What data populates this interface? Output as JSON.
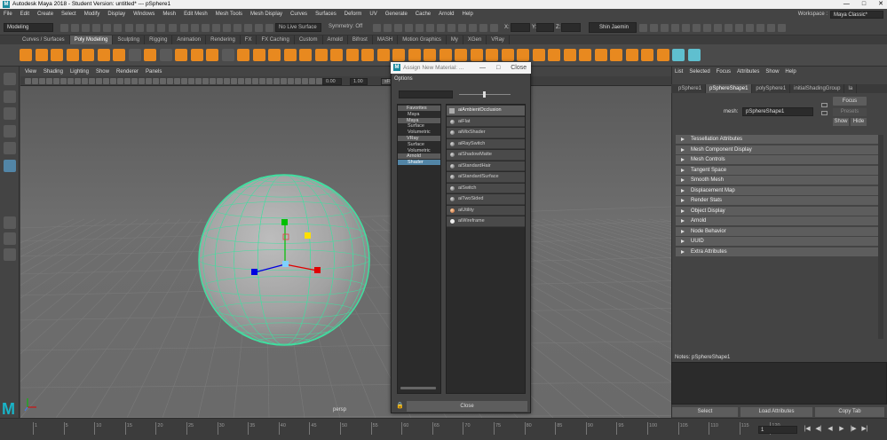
{
  "window": {
    "title": "Autodesk Maya 2018 - Student Version: untitled*   ---   pSphere1",
    "logo": "M",
    "min": "—",
    "max": "□",
    "close": "✕"
  },
  "menubar": {
    "items": [
      "File",
      "Edit",
      "Create",
      "Select",
      "Modify",
      "Display",
      "Windows",
      "Mesh",
      "Edit Mesh",
      "Mesh Tools",
      "Mesh Display",
      "Curves",
      "Surfaces",
      "Deform",
      "UV",
      "Generate",
      "Cache",
      "Arnold",
      "Help"
    ],
    "workspace_label": "Workspace :",
    "workspace_value": "Maya Classic*"
  },
  "status": {
    "mode": "Modeling",
    "live_surface": "No Live Surface",
    "symmetry": "Symmetry: Off",
    "x_label": "X:",
    "y_label": "Y:",
    "z_label": "Z:",
    "user": "Shin Jaemin"
  },
  "shelf_tabs": [
    "Curves / Surfaces",
    "Poly Modeling",
    "Sculpting",
    "Rigging",
    "Animation",
    "Rendering",
    "FX",
    "FX Caching",
    "Custom",
    "Arnold",
    "Bifrost",
    "MASH",
    "Motion Graphics",
    "My",
    "XGen",
    "VRay"
  ],
  "shelf_active": "Poly Modeling",
  "viewport": {
    "menu": [
      "View",
      "Shading",
      "Lighting",
      "Show",
      "Renderer",
      "Panels"
    ],
    "field1": "0.00",
    "field2": "1.00",
    "srgb": "sRG",
    "camera": "persp",
    "accent": "#3fe0a0"
  },
  "channel_box": {
    "menu": [
      "List",
      "Selected",
      "Focus",
      "Attributes",
      "Show",
      "Help"
    ],
    "tabs": [
      "pSphere1",
      "pSphereShape1",
      "polySphere1",
      "initialShadingGroup",
      "la"
    ],
    "active_tab": "pSphereShape1",
    "mesh_label": "mesh:",
    "mesh_value": "pSphereShape1",
    "focus": "Focus",
    "presets": "Presets",
    "show": "Show",
    "hide": "Hide",
    "attributes": [
      "Tessellation Attributes",
      "Mesh Component Display",
      "Mesh Controls",
      "Tangent Space",
      "Smooth Mesh",
      "Displacement Map",
      "Render Stats",
      "Object Display",
      "Arnold",
      "Node Behavior",
      "UUID",
      "Extra Attributes"
    ],
    "notes_label": "Notes:  pSphereShape1",
    "bottom": [
      "Select",
      "Load Attributes",
      "Copy Tab"
    ]
  },
  "dialog": {
    "title": "Assign New Material: ...",
    "min": "—",
    "max": "□",
    "close": "Close",
    "options": "Options",
    "tree": [
      {
        "label": "Favorites",
        "type": "h"
      },
      {
        "label": "Maya",
        "type": "c"
      },
      {
        "label": "Maya",
        "type": "h"
      },
      {
        "label": "Surface",
        "type": "c"
      },
      {
        "label": "Volumetric",
        "type": "c"
      },
      {
        "label": "VRay",
        "type": "h"
      },
      {
        "label": "Surface",
        "type": "c"
      },
      {
        "label": "Volumetric",
        "type": "c"
      },
      {
        "label": "Arnold",
        "type": "h"
      },
      {
        "label": "Shader",
        "type": "sel"
      }
    ],
    "shaders": [
      "aiAmbientOcclusion",
      "aiFlat",
      "aiMixShader",
      "aiRaySwitch",
      "aiShadowMatte",
      "aiStandardHair",
      "aiStandardSurface",
      "aiSwitch",
      "aiTwoSided",
      "aiUtility",
      "aiWireframe"
    ]
  },
  "timeline": {
    "ticks": [
      "1",
      "5",
      "10",
      "15",
      "20",
      "25",
      "30",
      "35",
      "40",
      "45",
      "50",
      "55",
      "60",
      "65",
      "70",
      "75",
      "80",
      "85",
      "90",
      "95",
      "100",
      "105",
      "110",
      "115",
      "120"
    ],
    "current_frame": "1",
    "play": [
      "|◀",
      "◀|",
      "◀",
      "▶",
      "|▶",
      "▶|"
    ]
  }
}
